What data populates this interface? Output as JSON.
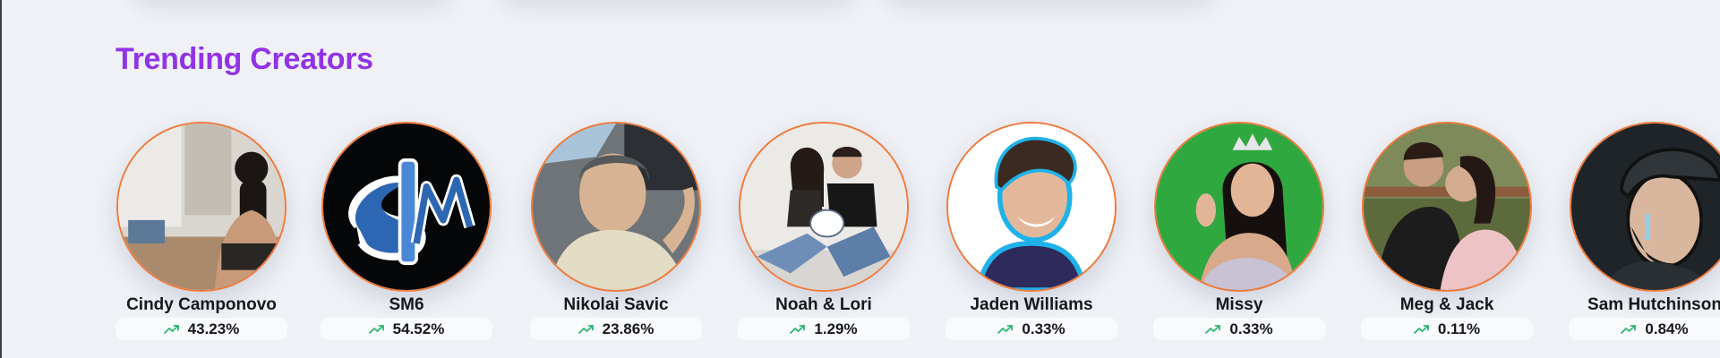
{
  "section": {
    "title": "Trending Creators"
  },
  "colors": {
    "title": "#9133e6",
    "avatar_ring": "#f07a3a",
    "trend_up": "#2bb673",
    "background": "#eff1f6"
  },
  "creators": [
    {
      "name": "Cindy Camponovo",
      "growth": "43.23%",
      "trend_icon": "trending-up-icon"
    },
    {
      "name": "SM6",
      "growth": "54.52%",
      "trend_icon": "trending-up-icon"
    },
    {
      "name": "Nikolai Savic",
      "growth": "23.86%",
      "trend_icon": "trending-up-icon"
    },
    {
      "name": "Noah & Lori",
      "growth": "1.29%",
      "trend_icon": "trending-up-icon"
    },
    {
      "name": "Jaden Williams",
      "growth": "0.33%",
      "trend_icon": "trending-up-icon"
    },
    {
      "name": "Missy",
      "growth": "0.33%",
      "trend_icon": "trending-up-icon"
    },
    {
      "name": "Meg & Jack",
      "growth": "0.11%",
      "trend_icon": "trending-up-icon"
    },
    {
      "name": "Sam Hutchinson",
      "growth": "0.84%",
      "trend_icon": "trending-up-icon"
    }
  ]
}
